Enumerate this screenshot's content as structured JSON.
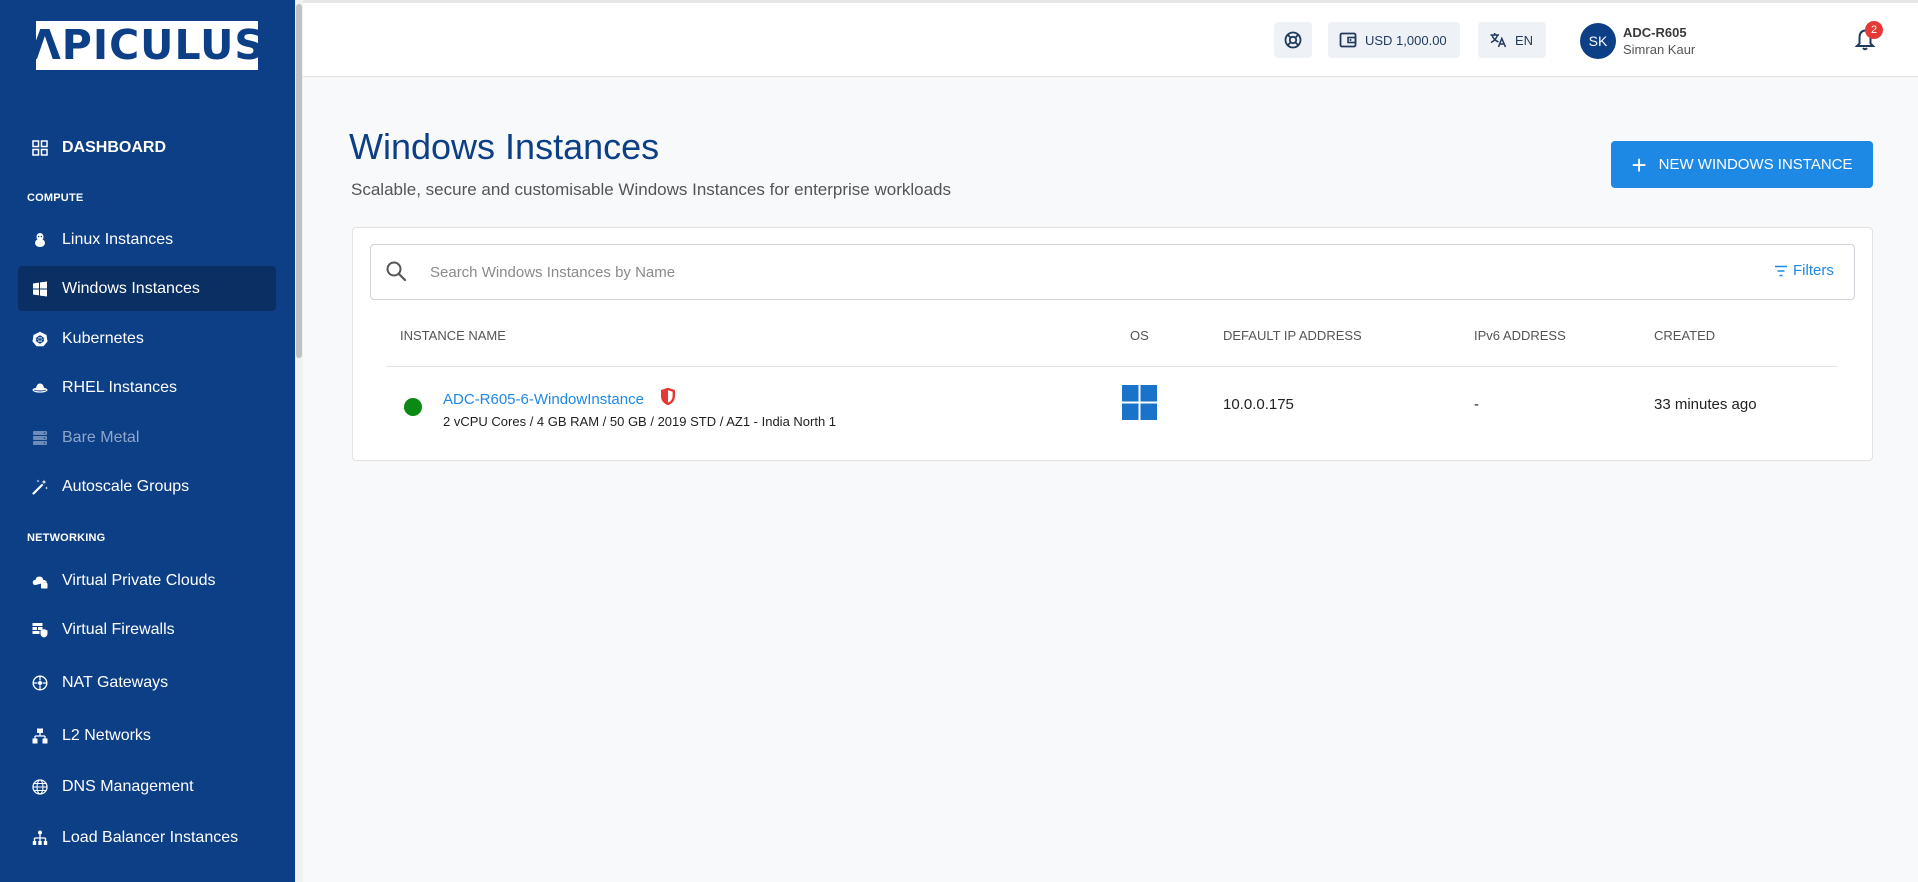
{
  "brand": {
    "logo_text": "ΛPICULUS"
  },
  "sidebar": {
    "dashboard": "DASHBOARD",
    "sections": {
      "compute": "COMPUTE",
      "networking": "NETWORKING"
    },
    "compute_items": [
      {
        "label": "Linux Instances",
        "icon": "linux-icon"
      },
      {
        "label": "Windows Instances",
        "icon": "windows-icon",
        "active": true
      },
      {
        "label": "Kubernetes",
        "icon": "kubernetes-icon"
      },
      {
        "label": "RHEL Instances",
        "icon": "redhat-icon"
      },
      {
        "label": "Bare Metal",
        "icon": "server-icon",
        "disabled": true
      },
      {
        "label": "Autoscale Groups",
        "icon": "magic-wand-icon"
      }
    ],
    "networking_items": [
      {
        "label": "Virtual Private Clouds",
        "icon": "cloud-lock-icon"
      },
      {
        "label": "Virtual Firewalls",
        "icon": "firewall-icon"
      },
      {
        "label": "NAT Gateways",
        "icon": "nat-icon"
      },
      {
        "label": "L2 Networks",
        "icon": "network-icon"
      },
      {
        "label": "DNS Management",
        "icon": "globe-icon"
      },
      {
        "label": "Load Balancer Instances",
        "icon": "load-balancer-icon"
      }
    ]
  },
  "header": {
    "balance": "USD 1,000.00",
    "language": "EN",
    "avatar_initials": "SK",
    "account": "ADC-R605",
    "user": "Simran Kaur",
    "notification_count": "2"
  },
  "main": {
    "title": "Windows Instances",
    "subtitle": "Scalable, secure and customisable Windows Instances for enterprise workloads",
    "new_button": "NEW WINDOWS INSTANCE",
    "search_placeholder": "Search Windows Instances by Name",
    "filters": "Filters",
    "columns": [
      "INSTANCE NAME",
      "OS",
      "DEFAULT IP ADDRESS",
      "IPv6 ADDRESS",
      "CREATED"
    ],
    "rows": [
      {
        "name": "ADC-R605-6-WindowInstance",
        "spec": "2 vCPU Cores / 4 GB RAM / 50 GB / 2019 STD / AZ1 - India North 1",
        "os": "windows-logo-icon",
        "ip": "10.0.0.175",
        "ipv6": "-",
        "created": "33 minutes ago",
        "status_color": "#0a8a15"
      }
    ]
  },
  "colors": {
    "sidebar_bg": "#0d3f86",
    "accent": "#1e88e5",
    "status_running": "#0a8a15",
    "badge": "#e53935"
  }
}
